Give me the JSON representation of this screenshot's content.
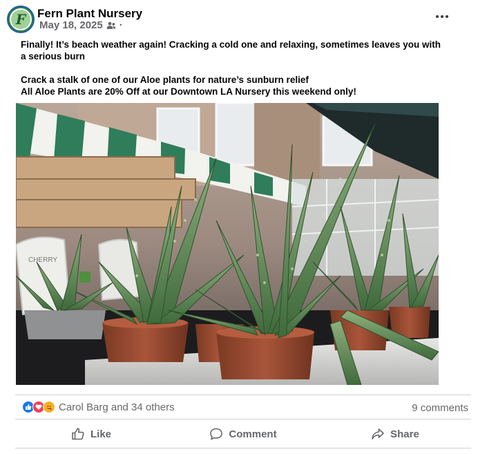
{
  "post": {
    "page_name": "Fern Plant Nursery",
    "avatar_letter": "F",
    "date": "May 18, 2025",
    "date_suffix": "·",
    "audience_icon": "friends-icon",
    "menu_icon": "more-options-icon",
    "text_lines": [
      "Finally! It’s beach weather again! Cracking a cold one and relaxing, sometimes leaves you with",
      "a serious burn",
      "Crack a stalk of one of our Aloe plants for nature’s sunburn relief",
      "All Aloe Plants are 20% Off at our Downtown LA Nursery this weekend only!"
    ]
  },
  "photo": {
    "tag_text": "CHERRY",
    "colors": {
      "awning_green": "#2f7d5a",
      "pot": "#9b4a2c",
      "leaf": "#5f8f55"
    }
  },
  "engagement": {
    "reaction_icons": [
      "like-icon",
      "love-icon",
      "care-icon"
    ],
    "reactors": "Carol Barg and 34 others",
    "comments": "9 comments"
  },
  "actions": {
    "like": "Like",
    "comment": "Comment",
    "share": "Share"
  },
  "colors": {
    "brand_blue": "#1877f2",
    "love_red": "#f33e58",
    "muted_text": "#65676b"
  }
}
